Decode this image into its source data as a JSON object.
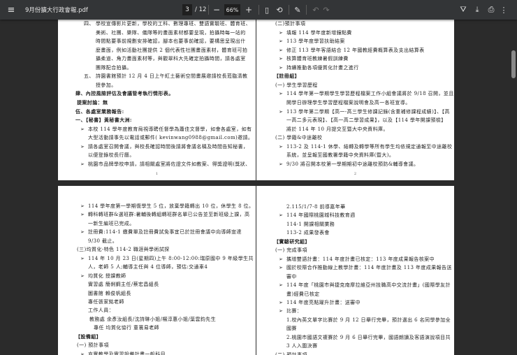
{
  "toolbar": {
    "menu_icon": "hamburger-icon",
    "title": "9月份擴大行政會報.pdf",
    "current_page": "3",
    "total_pages": "/ 12",
    "zoom_out": "−",
    "zoom_level": "66%",
    "zoom_in": "+",
    "fit_icon": "▯",
    "rotate_icon": "⟲",
    "annotate_icon": "✎",
    "undo_icon": "↶",
    "redo_icon": "↷",
    "drive_icon": "⛛",
    "download_icon": "⤓",
    "print_icon": "⎙",
    "more_icon": "⋮"
  },
  "pages": [
    {
      "page_number": "1",
      "lines": [
        {
          "type": "num",
          "label": "四、",
          "text": "學校宣傳影片更新，學校的工科、數理專班、雙語實驗班、體育班、"
        },
        {
          "type": "cont",
          "text": "美術、社團、樂隊、儀隊等的畫面素材都要呈現，拍攝時每一站的"
        },
        {
          "type": "cont",
          "text": "時間點要事前規劃安排確認，腳本也要事前確認，要構思呈現出什"
        },
        {
          "type": "cont",
          "text": "麼畫面，例如活動社團提供 2 個代表性社團畫面素材，體育班可拍"
        },
        {
          "type": "cont",
          "text": "攝柔道、角力畫面素材等，與觀翠科大先確定拍攝時間，請各處室"
        },
        {
          "type": "cont",
          "text": "團隊配合拍攝。"
        },
        {
          "type": "num",
          "label": "五、",
          "text": "詩園書館預計 12 月 4 日上午紅土藝術空間畫展邀請校長蒞臨清教"
        },
        {
          "type": "cont",
          "text": "授參加。"
        },
        {
          "type": "h0",
          "text": "肆、內控風險評估及會議管考執行情形表。",
          "bold": true
        },
        {
          "type": "h1",
          "text": "提案討論：無",
          "bold": true
        },
        {
          "type": "h0",
          "text": "伍、各處室業務報告:",
          "bold": true
        },
        {
          "type": "h0",
          "text": "一、【秘書】黃秘書大洲:",
          "bold": true
        },
        {
          "type": "bullet",
          "text": "本校 114 學年度教育局視導聘任督學為蕭佳文督學，如會各處室，如有"
        },
        {
          "type": "bcont",
          "text": "大型活動請事先以電話或郵件( kevinwang0988@gmail.com)邀請。"
        },
        {
          "type": "bullet",
          "text": "請各處室召開會議，與校長確認時間後請將會議名稱及時間告知秘書，"
        },
        {
          "type": "bcont",
          "text": "以便登錄校長行曆。"
        },
        {
          "type": "bullet",
          "text": "桃園市品牌學校申請，請相關處室將佐證文件如教案、得獎證明(獎狀、"
        }
      ]
    },
    {
      "page_number": "2",
      "lines": [
        {
          "type": "h1",
          "text": "(二)預計事項"
        },
        {
          "type": "bullet",
          "text": "填報 114 學年度新增鐘點費"
        },
        {
          "type": "bullet",
          "text": "113 學年度學習扶助結案"
        },
        {
          "type": "bullet",
          "text": "修正 113 學年客語結合 12 年國教經費概算表及支出結算表"
        },
        {
          "type": "bullet",
          "text": "核算體育班教練暑假訓練費"
        },
        {
          "type": "bullet",
          "text": "持續推動各項優質化計畫之進行"
        },
        {
          "type": "h0",
          "text": "【註冊組】",
          "bold": true
        },
        {
          "type": "h1",
          "text": "(一) 學生學習歷程"
        },
        {
          "type": "bullet",
          "text": "114 學年第一學期學生學習歷程檔案工作小組會議將於 9/18 召開，並且"
        },
        {
          "type": "bcont",
          "text": "開學日辦理學生學習歷程檔案說明會及高一各班宣導。"
        },
        {
          "type": "bullet",
          "text": "113 學年第二學期【高一-高三學生修課記錄(含重補修課程成績)】、【高"
        },
        {
          "type": "bcont",
          "text": "一高二多元表現】、【高一高二學習成果】，以及【114 學年開課預檢】"
        },
        {
          "type": "bcont",
          "text": "將於 114 年 10 月提交至暨大中央資料庫。"
        },
        {
          "type": "h1",
          "text": "(二) 學籍&中途離校"
        },
        {
          "type": "bullet",
          "text": "113-2 及 114-1 休學、結轉及轉學等所有學生均依規定通報至中途離校"
        },
        {
          "type": "bcont",
          "text": "系統，並呈報至國教署學籍中央資料庫(暨大)。"
        },
        {
          "type": "bullet",
          "text": "9/30 將召開本校第一學期期初中途離校預防&輔導會議。"
        }
      ]
    },
    {
      "page_number": "",
      "lines": [
        {
          "type": "bullet",
          "text": "114 學年度第一學期復學生 5 位，放棄學籍轉出 10 位，休學生 8 位。"
        },
        {
          "type": "bullet",
          "text": "轉科轉班群&選班群:暑輔後轉組轉班群名單已公告並至新班級上課，高"
        },
        {
          "type": "bcont",
          "text": "一新生編班已完成。"
        },
        {
          "type": "bullet",
          "text": "註冊費:114-1 繳費單及註冊費試免事宜已於註冊會議中向導師宣達"
        },
        {
          "type": "bcont",
          "text": "9/30 截止。"
        },
        {
          "type": "h1",
          "text": "(三)均質化-特色 114-2 職涯與學術試探"
        },
        {
          "type": "bullet",
          "text": "114 年 10 月 23 日(星期四)上午 8:00-12:00:瑞原國中 9 年級學生共 75"
        },
        {
          "type": "bcont",
          "text": "人，老師 5 人;輔導主任與 4 位導師，預估:交通車4"
        },
        {
          "type": "bullet",
          "text": "均質化 授課教師"
        },
        {
          "type": "bcont",
          "text": "實習處 簡俐鋼主任/蔡宏昌組長"
        },
        {
          "type": "bcont",
          "text": "圖書館 賴俊帆組長"
        },
        {
          "type": "bcont",
          "text": "專任張家銘老師"
        },
        {
          "type": "bcont",
          "text": "工作人員："
        },
        {
          "type": "bcont2",
          "text": "教務處 余彥汝組長/沈詩琳小姐/楊淳惠小姐/葉雲鈞先生"
        },
        {
          "type": "bcont3",
          "text": "專任 均質化協行 童寰易老師"
        },
        {
          "type": "h0",
          "text": "【設備組】",
          "bold": true
        },
        {
          "type": "h1",
          "text": "(一) 預計事項"
        },
        {
          "type": "bullet",
          "text": "充實教學及實習設備計畫一般科目"
        }
      ]
    },
    {
      "page_number": "",
      "lines": [
        {
          "type": "bcont",
          "text": "2.115/1/7-8 前導嘉年華"
        },
        {
          "type": "bullet",
          "text": "114 年國際桃園城科技教育週"
        },
        {
          "type": "bcont",
          "text": "114-1 開課相關業務"
        },
        {
          "type": "bcont",
          "text": "113-2 成果發表會"
        },
        {
          "type": "h0",
          "text": "【實驗研究組】",
          "bold": true
        },
        {
          "type": "h1",
          "text": "(一) 完成事項"
        },
        {
          "type": "bullet",
          "text": "攜增雙語計畫：114 年度計畫已核定：113 年度成果報告核案中"
        },
        {
          "type": "bullet",
          "text": "國於校際合作推動線上教學計畫：114 年度計畫及 113 年度成果報告送"
        },
        {
          "type": "bcont",
          "text": "審中"
        },
        {
          "type": "bullet",
          "text": "114 年度「桃園市與捷克南摩拉維亞州技職高中交流計畫」(國際學友計"
        },
        {
          "type": "bcont",
          "text": "畫)經費已核定"
        },
        {
          "type": "bullet",
          "text": "114 年度亮點躍升計畫：送審中"
        },
        {
          "type": "bullet",
          "text": "比賽："
        },
        {
          "type": "bcont",
          "text": "1.校內英文單字比賽於 9 月 12 日舉行完畢，預計選出 6 名同學參加全"
        },
        {
          "type": "bcont",
          "text": "國賽"
        },
        {
          "type": "bcont",
          "text": "2.桃園市國語文複賽於 9 月 6 日舉行完畢，國語朗讀及客語演說項目共"
        },
        {
          "type": "bcont",
          "text": "3 人入圍決賽"
        },
        {
          "type": "h1",
          "text": "(二) 預計事項"
        }
      ]
    }
  ]
}
